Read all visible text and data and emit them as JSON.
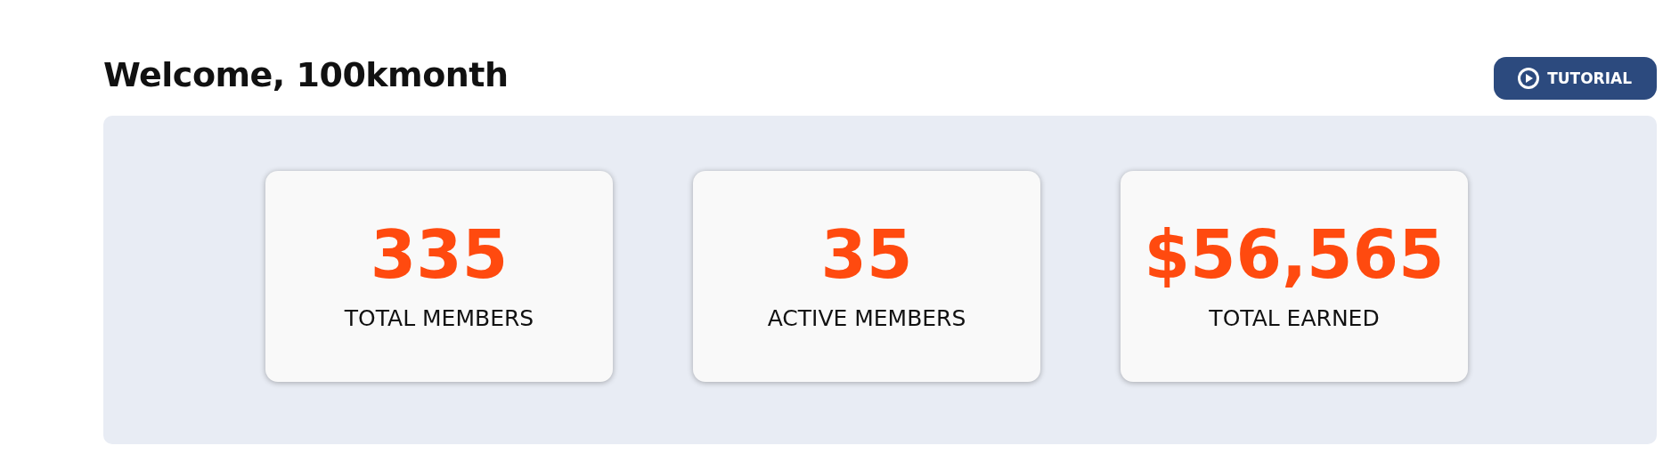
{
  "header": {
    "title": "Welcome, 100kmonth",
    "tutorial_button": {
      "label": "TUTORIAL"
    }
  },
  "stats": [
    {
      "value": "335",
      "label": "TOTAL MEMBERS"
    },
    {
      "value": "35",
      "label": "ACTIVE MEMBERS"
    },
    {
      "value": "$56,565",
      "label": "TOTAL EARNED"
    }
  ]
}
